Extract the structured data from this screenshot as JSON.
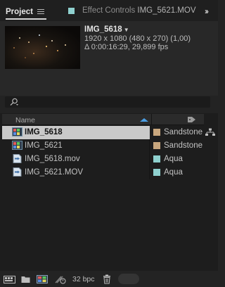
{
  "tabs": {
    "project": "Project",
    "effect_controls_prefix": "Effect Controls ",
    "effect_controls_target": "IMG_5621.MOV"
  },
  "preview": {
    "title": "IMG_5618",
    "resolution": "1920 x 1080  (480 x 270) (1,00)",
    "duration": "Δ 0:00:16:29, 29,899 fps"
  },
  "list": {
    "header_name": "Name",
    "rows": [
      {
        "name": "IMG_5618",
        "label": "Sandstone",
        "color": "#c9a77e",
        "kind": "composition",
        "selected": true
      },
      {
        "name": "IMG_5621",
        "label": "Sandstone",
        "color": "#c9a77e",
        "kind": "composition",
        "selected": false
      },
      {
        "name": "IMG_5618.mov",
        "label": "Aqua",
        "color": "#8fd1cf",
        "kind": "footage",
        "selected": false
      },
      {
        "name": "IMG_5621.MOV",
        "label": "Aqua",
        "color": "#8fd1cf",
        "kind": "footage",
        "selected": false
      }
    ]
  },
  "toolbar": {
    "bit_depth": "32 bpc"
  },
  "icons": [
    "menu-icon",
    "expand-panels-icon",
    "search-icon",
    "sort-ascending-icon",
    "label-tag-icon",
    "composition-icon",
    "footage-icon",
    "flowchart-icon",
    "interpret-footage-icon",
    "folder-icon",
    "new-composition-icon",
    "project-settings-icon",
    "trash-icon"
  ]
}
